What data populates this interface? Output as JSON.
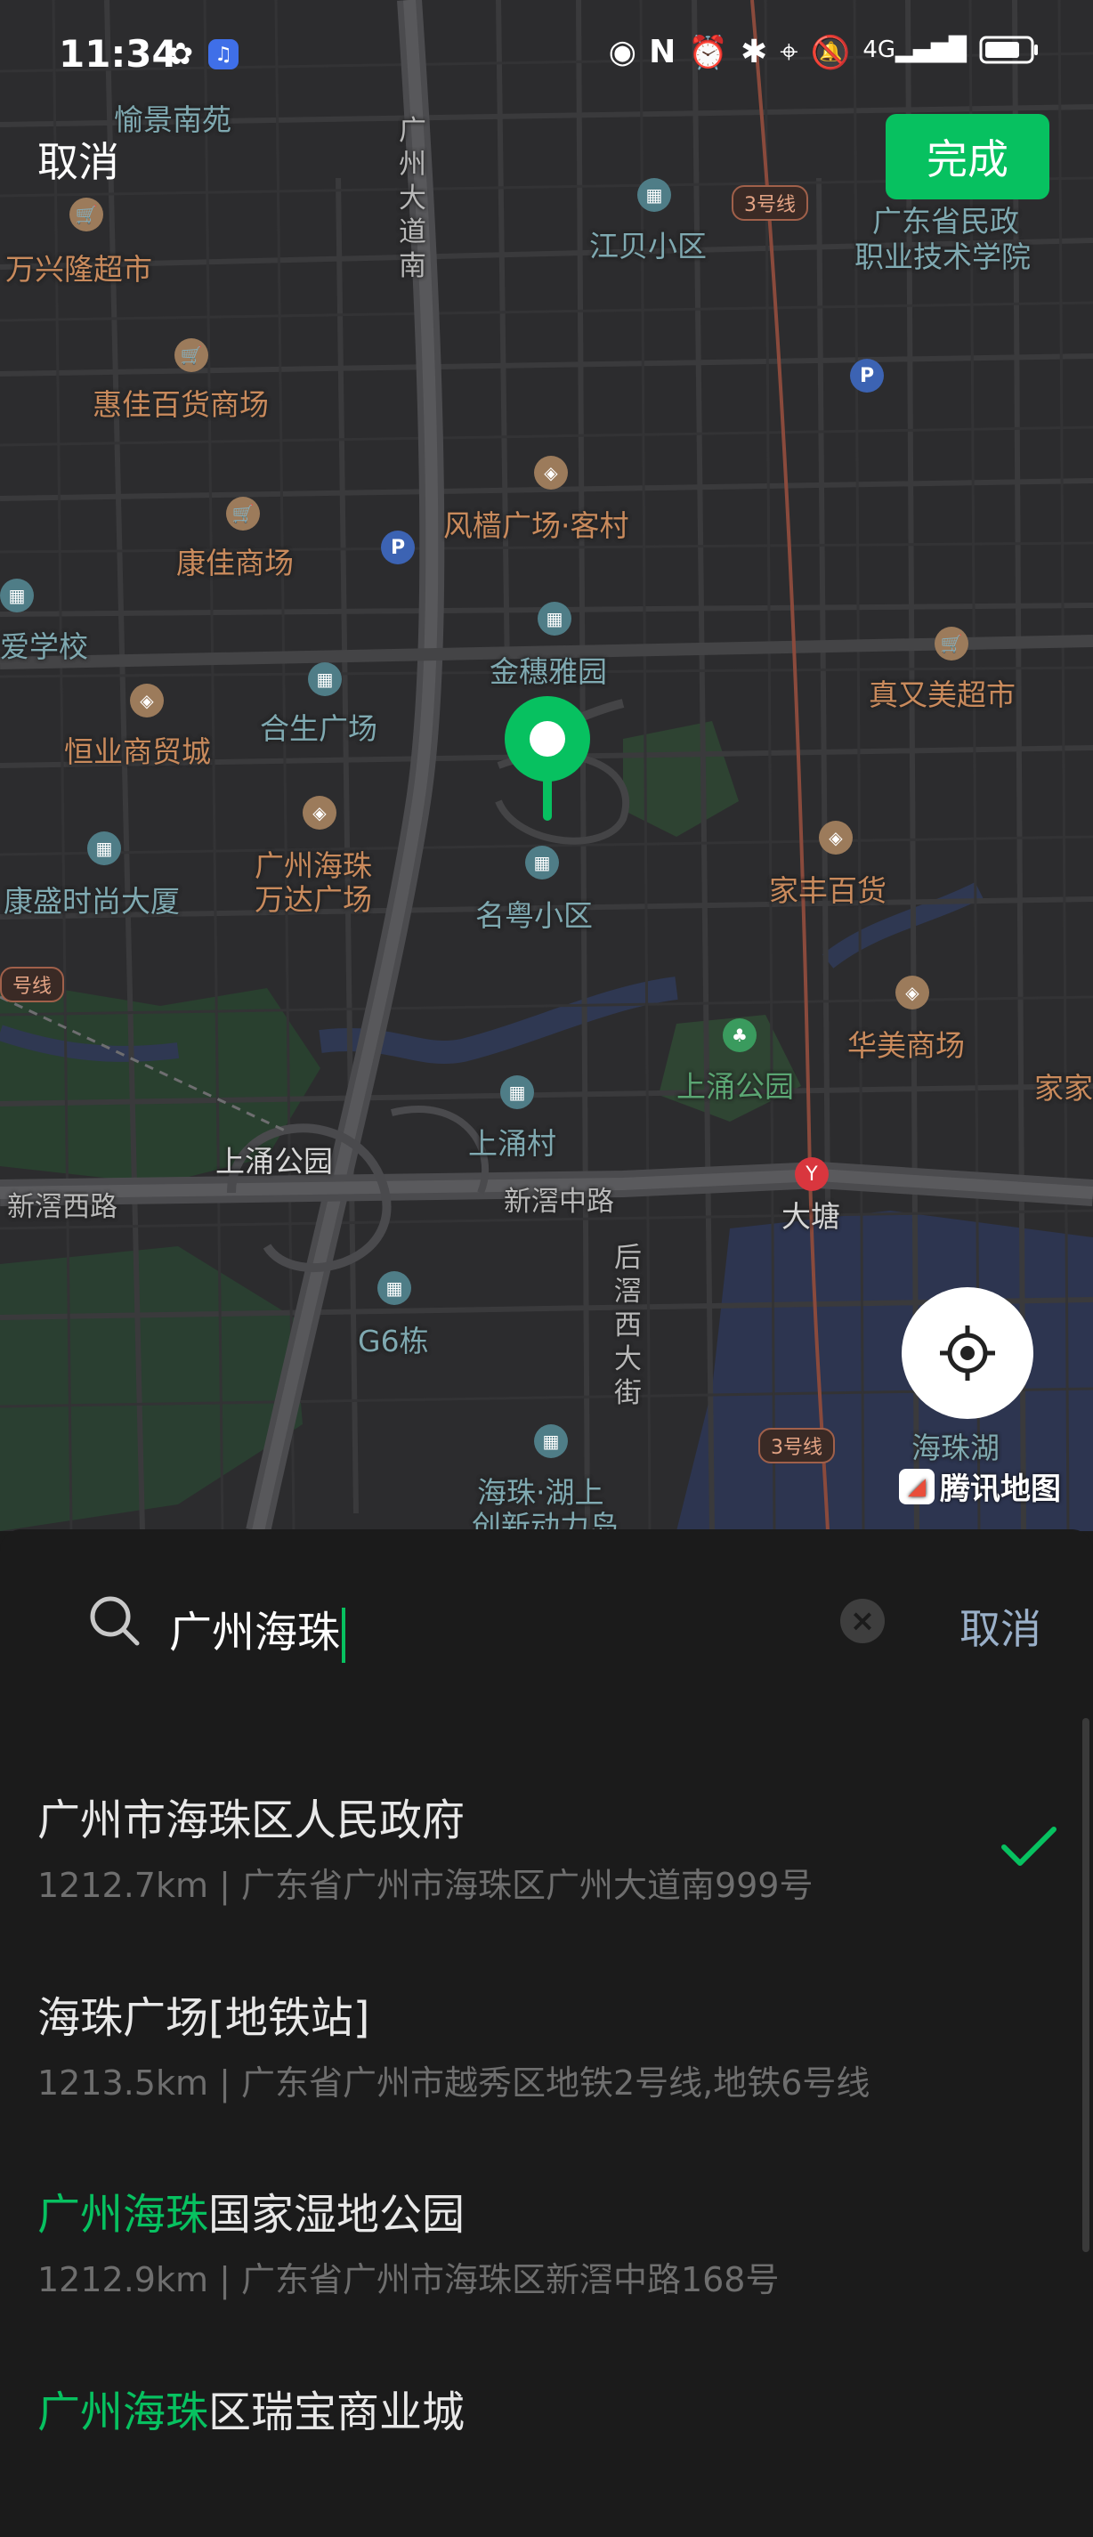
{
  "status_bar": {
    "time": "11:34",
    "icons": [
      "wechat-icon",
      "music-app-icon",
      "eye-icon",
      "nfc-icon",
      "alarm-icon",
      "bluetooth-icon",
      "location-icon",
      "mute-icon",
      "4g-signal-icon",
      "battery-icon"
    ],
    "network": "4G"
  },
  "header": {
    "cancel_label": "取消",
    "done_label": "完成"
  },
  "map": {
    "labels": {
      "yujing": "愉景南苑",
      "guangzhou_dadao": "广州大道南",
      "jiangbei": "江贝小区",
      "line3_top": "3号线",
      "college": "广东省民政职业技术学院",
      "college_l1": "广东省民政",
      "college_l2": "职业技术学院",
      "wanxinglong": "万兴隆超市",
      "huijia": "惠佳百货商场",
      "fengqiang": "风樯广场·客村",
      "kangjia": "康佳商场",
      "school": "爱学校",
      "jinsui": "金穗雅园",
      "zhenyoumei": "真又美超市",
      "hesheng": "合生广场",
      "hengye": "恒业商贸城",
      "wanda_l1": "广州海珠",
      "wanda_l2": "万达广场",
      "kangsheng": "康盛时尚大厦",
      "mingyue": "名粤小区",
      "jiafeng": "家丰百货",
      "line_left": "号线",
      "huamei": "华美商场",
      "jiajia": "家家",
      "shangchong_park": "上涌公园",
      "shangchong_park2": "上涌公园",
      "shangchong_village": "上涌村",
      "xinjiao_west": "新滘西路",
      "xinjiao_mid": "新滘中路",
      "datang": "大塘",
      "houjiao": "后滘西大街",
      "g6": "G6栋",
      "line3_bottom": "3号线",
      "haizhu_lake": "海珠湖",
      "innovation_l1": "海珠·湖上",
      "innovation_l2": "创新动力岛"
    },
    "provider": "腾讯地图",
    "pin": "selected-location-pin"
  },
  "search": {
    "query": "广州海珠",
    "cancel_label": "取消"
  },
  "results": [
    {
      "highlight": "",
      "rest": "广州市海珠区人民政府",
      "subtitle": "1212.7km | 广东省广州市海珠区广州大道南999号",
      "selected": true
    },
    {
      "highlight": "",
      "rest": "海珠广场[地铁站]",
      "subtitle": "1213.5km | 广东省广州市越秀区地铁2号线,地铁6号线",
      "selected": false
    },
    {
      "highlight": "广州海珠",
      "rest": "国家湿地公园",
      "subtitle": "1212.9km | 广东省广州市海珠区新滘中路168号",
      "selected": false
    },
    {
      "highlight": "广州海珠",
      "rest": "区瑞宝商业城",
      "subtitle": "",
      "selected": false
    }
  ],
  "colors": {
    "accent": "#07c160",
    "map_bg": "#2c2c2e",
    "sheet_bg": "#1b1b1b",
    "shop_label": "#c98a5c",
    "building_label": "#7fa9b1"
  }
}
